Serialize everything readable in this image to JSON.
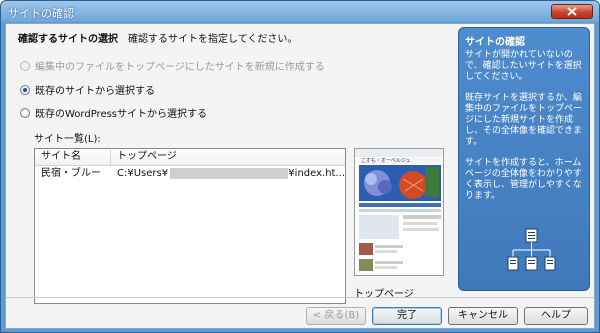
{
  "window": {
    "title": "サイトの確認"
  },
  "step": {
    "title": "確認するサイトの選択",
    "description": "確認するサイトを指定してください。"
  },
  "options": [
    {
      "label": "編集中のファイルをトップページにしたサイトを新規に作成する",
      "checked": false,
      "disabled": true
    },
    {
      "label": "既存のサイトから選択する",
      "checked": true,
      "disabled": false
    },
    {
      "label": "既存のWordPressサイトから選択する",
      "checked": false,
      "disabled": false
    }
  ],
  "site_list": {
    "label": "サイト一覧(L):",
    "columns": [
      "サイト名",
      "トップページ"
    ],
    "rows": [
      {
        "name": "民宿・ブルー",
        "path_start": "C:¥Users¥",
        "path_end": "¥index.ht..."
      }
    ]
  },
  "preview": {
    "caption": "トップページ",
    "site_heading": "こすも・オーベルジュ"
  },
  "side_panel": {
    "title": "サイトの確認",
    "paragraphs": [
      "サイトが開かれていないので、確認したいサイトを選択してください。",
      "既存サイトを選択するか、編集中のファイルをトップページにした新規サイトを作成し、その全体像を確認できます。",
      "サイトを作成すると、ホームページの全体像をわかりやすく表示し、管理がしやすくなります。"
    ]
  },
  "buttons": {
    "back": "< 戻る(B)",
    "done": "完了",
    "cancel": "キャンセル",
    "help": "ヘルプ"
  },
  "colors": {
    "side_panel": "#4a86c8",
    "title_bar": "#6fa6d9",
    "close_button": "#c8442b"
  }
}
